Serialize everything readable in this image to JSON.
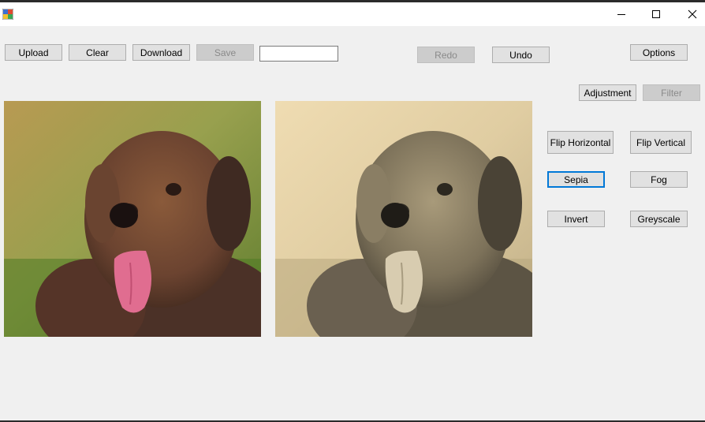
{
  "window": {
    "title": "",
    "controls": {
      "minimize": "minimize",
      "maximize": "maximize",
      "close": "close"
    }
  },
  "toolbar": {
    "upload": "Upload",
    "clear": "Clear",
    "download": "Download",
    "save": "Save",
    "filename_value": "",
    "redo": "Redo",
    "undo": "Undo",
    "options": "Options"
  },
  "modes": {
    "adjustment": "Adjustment",
    "filter": "Filter"
  },
  "effects": {
    "flip_horizontal": "Flip Horizontal",
    "flip_vertical": "Flip Vertical",
    "sepia": "Sepia",
    "fog": "Fog",
    "invert": "Invert",
    "greyscale": "Greyscale"
  },
  "images": {
    "original": {
      "subject": "curly brown dog with pink tongue",
      "tone": "color"
    },
    "processed": {
      "subject": "curly brown dog with pink tongue",
      "tone": "sepia"
    }
  },
  "colors": {
    "window_bg": "#f0f0f0",
    "button_bg": "#e1e1e1",
    "focus_accent": "#0078d7"
  },
  "icons": {
    "app": "app-icon",
    "minimize": "minimize-icon",
    "maximize": "maximize-icon",
    "close": "close-icon"
  }
}
